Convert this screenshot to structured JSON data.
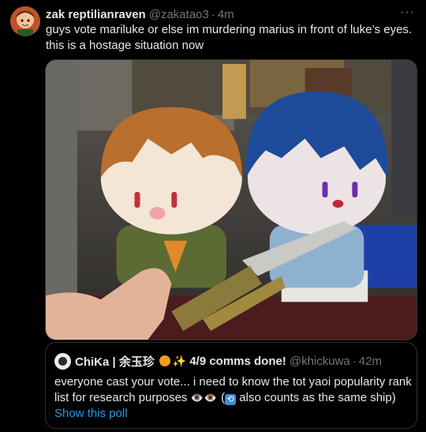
{
  "post": {
    "display_name": "zak reptilianraven",
    "handle": "@zakatao3",
    "separator": "·",
    "time": "4m",
    "more_icon": "···",
    "text": "guys vote mariluke or else im murdering marius in front of luke’s eyes. this is a hostage situation now"
  },
  "quoted": {
    "display_name": "ChiKa | 余玉珍",
    "status": "4/9 comms done!",
    "handle": "@khickuwa",
    "separator": "·",
    "time": "42m",
    "text_part1": "everyone cast your vote... i need to know the tot yaoi popularity rank list for research purposes ",
    "eyes": "👁️👁️",
    "text_part2": " (",
    "repost_icon": "⟲",
    "text_part3": " also counts as the same ship)",
    "show_poll": "Show this poll"
  },
  "colors": {
    "background": "#000000",
    "text": "#e7e9ea",
    "muted": "#71767b",
    "link": "#1d9bf0",
    "border": "#2f3336"
  },
  "icons": [
    "avatar-image",
    "more-icon",
    "orange-circle-emoji",
    "sparkles-emoji",
    "eyes-emoji",
    "repost-emoji"
  ]
}
